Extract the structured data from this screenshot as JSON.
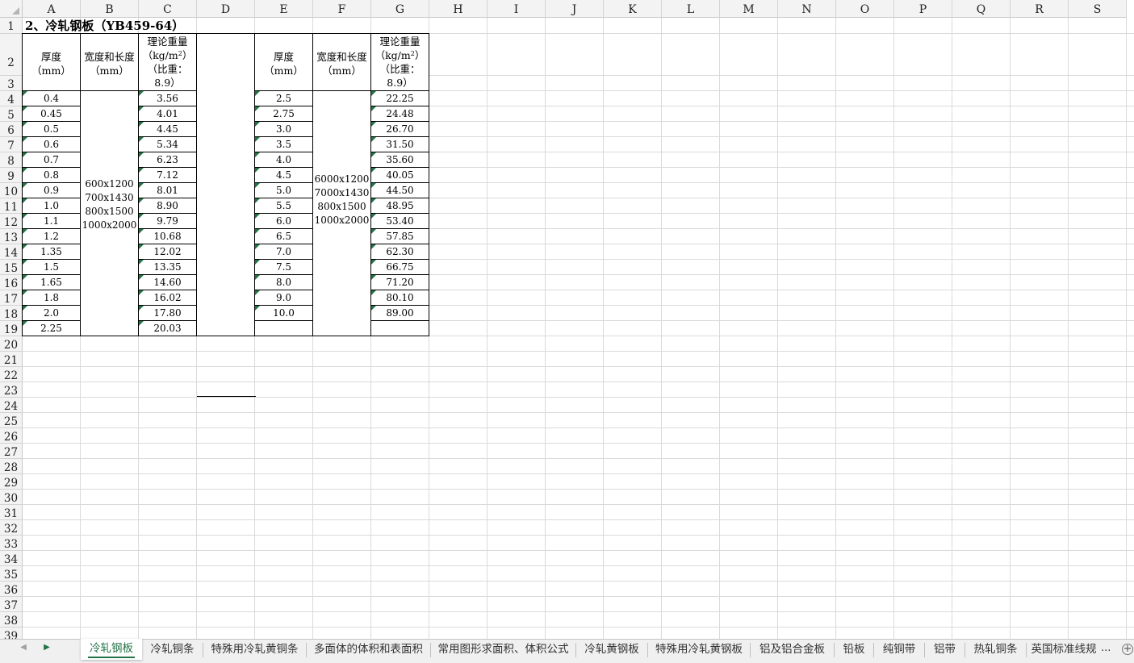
{
  "sheet": {
    "columns": [
      "A",
      "B",
      "C",
      "D",
      "E",
      "F",
      "G",
      "H",
      "I",
      "J",
      "K",
      "L",
      "M",
      "N",
      "O",
      "P",
      "Q",
      "R",
      "S"
    ],
    "rows": [
      "1",
      "2",
      "3",
      "4",
      "5",
      "6",
      "7",
      "8",
      "9",
      "10",
      "11",
      "12",
      "13",
      "14",
      "15",
      "16",
      "17",
      "18",
      "19",
      "20",
      "21",
      "22",
      "23",
      "24",
      "25",
      "26",
      "27",
      "28",
      "29",
      "30",
      "31",
      "32",
      "33",
      "34",
      "35",
      "36",
      "37",
      "38",
      "39"
    ],
    "title": "2、冷轧钢板（YB459-64）",
    "headers": {
      "thickness": [
        "厚度",
        "（mm）"
      ],
      "width_length": [
        "宽度和长度",
        "（mm）"
      ],
      "weight": [
        "理论重量",
        "（kg/m",
        "2",
        "）",
        "（比重：",
        "8.9）"
      ]
    },
    "left": {
      "thickness": [
        "0.4",
        "0.45",
        "0.5",
        "0.6",
        "0.7",
        "0.8",
        "0.9",
        "1.0",
        "1.1",
        "1.2",
        "1.35",
        "1.5",
        "1.65",
        "1.8",
        "2.0",
        "2.25"
      ],
      "sizes": [
        "600x1200",
        "700x1430",
        "800x1500",
        "1000x2000"
      ],
      "weight": [
        "3.56",
        "4.01",
        "4.45",
        "5.34",
        "6.23",
        "7.12",
        "8.01",
        "8.90",
        "9.79",
        "10.68",
        "12.02",
        "13.35",
        "14.60",
        "16.02",
        "17.80",
        "20.03"
      ]
    },
    "right": {
      "thickness": [
        "2.5",
        "2.75",
        "3.0",
        "3.5",
        "4.0",
        "4.5",
        "5.0",
        "5.5",
        "6.0",
        "6.5",
        "7.0",
        "7.5",
        "8.0",
        "9.0",
        "10.0",
        ""
      ],
      "sizes": [
        "6000x1200",
        "7000x1430",
        "800x1500",
        "1000x2000"
      ],
      "weight": [
        "22.25",
        "24.48",
        "26.70",
        "31.50",
        "35.60",
        "40.05",
        "44.50",
        "48.95",
        "53.40",
        "57.85",
        "62.30",
        "66.75",
        "71.20",
        "80.10",
        "89.00",
        ""
      ]
    }
  },
  "tabs": [
    "冷轧钢板",
    "冷轧铜条",
    "特殊用冷轧黄铜条",
    "多面体的体积和表面积",
    "常用图形求面积、体积公式",
    "冷轧黄钢板",
    "特殊用冷轧黄钢板",
    "铝及铝合金板",
    "铅板",
    "纯铜带",
    "铝带",
    "热轧铜条",
    "英国标准线规"
  ],
  "tab_more": "...",
  "tab_add": "+",
  "nav": {
    "prev": "◀",
    "next": "▶"
  },
  "colors": {
    "accent": "#217346",
    "gridline": "#dadada",
    "header_bg": "#f3f3f3"
  }
}
